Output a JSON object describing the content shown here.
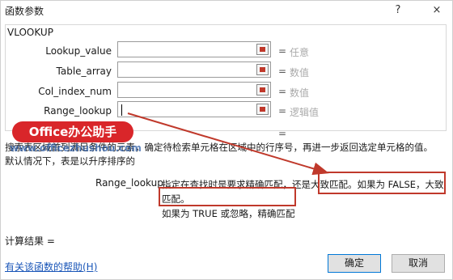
{
  "window": {
    "title": "函数参数",
    "help_button": "?",
    "close_button": "×"
  },
  "function_name": "VLOOKUP",
  "args": [
    {
      "label": "Lookup_value",
      "value": "",
      "hint": "任意"
    },
    {
      "label": "Table_array",
      "value": "",
      "hint": "数值"
    },
    {
      "label": "Col_index_num",
      "value": "",
      "hint": "数值"
    },
    {
      "label": "Range_lookup",
      "value": "",
      "hint": "逻辑值"
    }
  ],
  "equals": "=",
  "description": "搜索表区域首列满足条件的元素，确定待检索单元格在区域中的行序号，再进一步返回选定单元格的值。默认情况下，表是以升序排序的",
  "arg_desc": {
    "label": "Range_lookup",
    "part1": "指定在查找时是要求精确匹配，还是大致匹配。",
    "part2": "如果为 FALSE，大致匹配。",
    "part3": "如果为 TRUE 或忽略，精确匹配"
  },
  "overlay": {
    "badge": "Office办公助手",
    "watermark": "www.officezhushou.com"
  },
  "result_label": "计算结果 =",
  "help_link": "有关该函数的帮助(H)",
  "buttons": {
    "ok": "确定",
    "cancel": "取消"
  },
  "colors": {
    "annotation_red": "#c0392b",
    "badge_red": "#d9262a",
    "link_blue": "#1a56b8"
  }
}
